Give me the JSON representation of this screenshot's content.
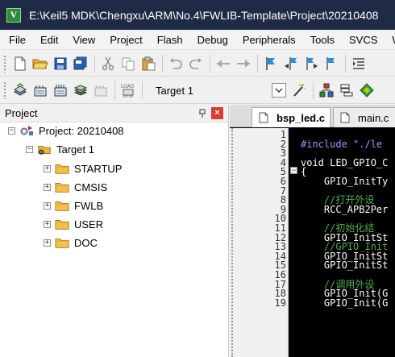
{
  "window": {
    "title": "E:\\Keil5 MDK\\Chengxu\\ARM\\No.4\\FWLIB-Template\\Project\\20210408",
    "app_icon_letter": "V"
  },
  "menu": [
    "File",
    "Edit",
    "View",
    "Project",
    "Flash",
    "Debug",
    "Peripherals",
    "Tools",
    "SVCS",
    "W"
  ],
  "toolbar2": {
    "target_name": "Target 1",
    "load_label": "LOAD"
  },
  "project_panel": {
    "title": "Project",
    "close_glyph": "×",
    "root": "Project: 20210408",
    "target": "Target 1",
    "groups": [
      "STARTUP",
      "CMSIS",
      "FWLB",
      "USER",
      "DOC"
    ]
  },
  "editor": {
    "tabs": [
      {
        "label": "bsp_led.c",
        "active": true
      },
      {
        "label": "main.c",
        "active": false
      }
    ],
    "line_numbers": [
      "1",
      "2",
      "3",
      "4",
      "5",
      "6",
      "7",
      "8",
      "9",
      "10",
      "11",
      "12",
      "13",
      "14",
      "15",
      "16",
      "17",
      "18",
      "19"
    ],
    "lines": [
      {
        "text": "",
        "kind": "normal"
      },
      {
        "text": "#include \"./le",
        "kind": "preproc"
      },
      {
        "text": "",
        "kind": "normal"
      },
      {
        "text": "void LED_GPIO_C",
        "kind": "normal"
      },
      {
        "text": "{",
        "kind": "normal"
      },
      {
        "text": "    GPIO_InitTy",
        "kind": "normal"
      },
      {
        "text": "",
        "kind": "normal"
      },
      {
        "text": "    //打开外设",
        "kind": "comment"
      },
      {
        "text": "    RCC_APB2Per",
        "kind": "normal"
      },
      {
        "text": "",
        "kind": "normal"
      },
      {
        "text": "    //初始化结",
        "kind": "comment"
      },
      {
        "text": "    GPIO_InitSt",
        "kind": "normal"
      },
      {
        "text": "    //GPIO_Init",
        "kind": "comment"
      },
      {
        "text": "    GPIO_InitSt",
        "kind": "normal"
      },
      {
        "text": "    GPIO_InitSt",
        "kind": "normal"
      },
      {
        "text": "",
        "kind": "normal"
      },
      {
        "text": "    //调用外设",
        "kind": "comment"
      },
      {
        "text": "    GPIO_Init(G",
        "kind": "normal"
      },
      {
        "text": "    GPIO_Init(G",
        "kind": "normal"
      }
    ]
  }
}
